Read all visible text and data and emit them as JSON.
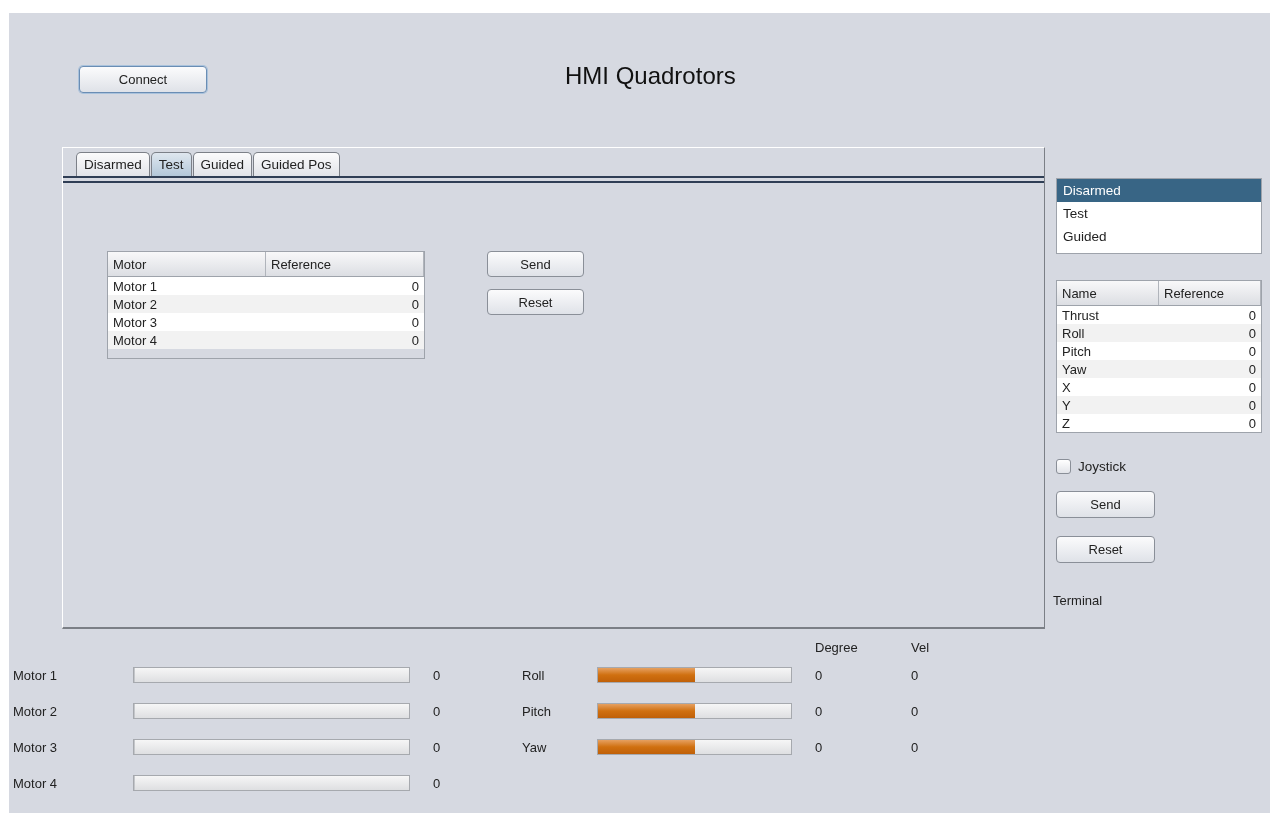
{
  "title": "HMI Quadrotors",
  "connect_button": "Connect",
  "tabs": [
    {
      "label": "Disarmed",
      "selected": false
    },
    {
      "label": "Test",
      "selected": true
    },
    {
      "label": "Guided",
      "selected": false
    },
    {
      "label": "Guided Pos",
      "selected": false
    }
  ],
  "motor_table": {
    "columns": [
      "Motor",
      "Reference"
    ],
    "rows": [
      [
        "Motor 1",
        "0"
      ],
      [
        "Motor 2",
        "0"
      ],
      [
        "Motor 3",
        "0"
      ],
      [
        "Motor 4",
        "0"
      ]
    ]
  },
  "tab_buttons": [
    "Send",
    "Reset"
  ],
  "mode_list": [
    {
      "label": "Disarmed",
      "selected": true
    },
    {
      "label": "Test",
      "selected": false
    },
    {
      "label": "Guided",
      "selected": false
    }
  ],
  "reference_table": {
    "columns": [
      "Name",
      "Reference"
    ],
    "rows": [
      [
        "Thrust",
        "0"
      ],
      [
        "Roll",
        "0"
      ],
      [
        "Pitch",
        "0"
      ],
      [
        "Yaw",
        "0"
      ],
      [
        "X",
        "0"
      ],
      [
        "Y",
        "0"
      ],
      [
        "Z",
        "0"
      ]
    ]
  },
  "joystick": {
    "label": "Joystick",
    "checked": false
  },
  "side_buttons": [
    "Send",
    "Reset"
  ],
  "terminal_label": "Terminal",
  "motors": [
    {
      "name": "Motor 1",
      "level": 0,
      "value": "0"
    },
    {
      "name": "Motor 2",
      "level": 0,
      "value": "0"
    },
    {
      "name": "Motor 3",
      "level": 0,
      "value": "0"
    },
    {
      "name": "Motor 4",
      "level": 0,
      "value": "0"
    }
  ],
  "attitude_headers": [
    "Degree",
    "Vel"
  ],
  "attitude": [
    {
      "name": "Roll",
      "level": 0.5,
      "degree": "0",
      "vel": "0"
    },
    {
      "name": "Pitch",
      "level": 0.5,
      "degree": "0",
      "vel": "0"
    },
    {
      "name": "Yaw",
      "level": 0.5,
      "degree": "0",
      "vel": "0"
    }
  ]
}
